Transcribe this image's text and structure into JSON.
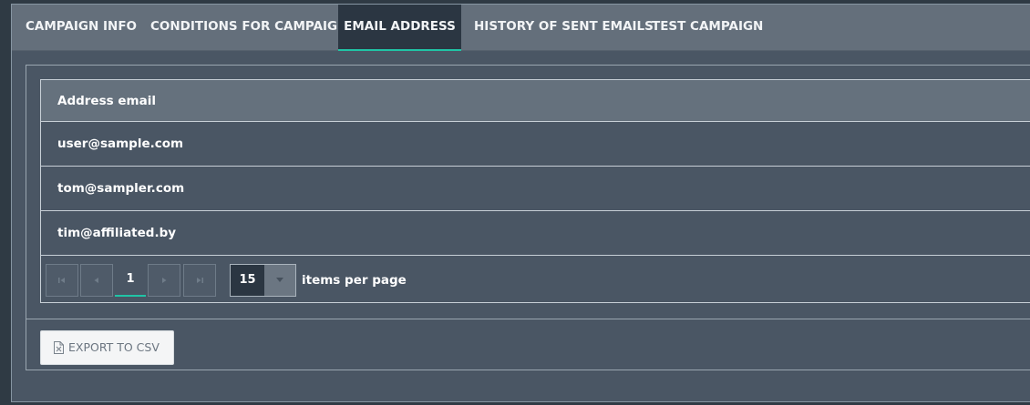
{
  "tabs": [
    {
      "label": "CAMPAIGN INFO",
      "active": false
    },
    {
      "label": "CONDITIONS FOR CAMPAIGN",
      "active": false
    },
    {
      "label": "EMAIL ADDRESS",
      "active": true
    },
    {
      "label": "HISTORY OF SENT EMAILS",
      "active": false
    },
    {
      "label": "TEST CAMPAIGN",
      "active": false
    }
  ],
  "grid": {
    "columns": [
      "Address email"
    ],
    "rows": [
      [
        "user@sample.com"
      ],
      [
        "tom@sampler.com"
      ],
      [
        "tim@affiliated.by"
      ]
    ]
  },
  "pager": {
    "first_icon": "first-page-icon",
    "prev_icon": "prev-page-icon",
    "current_page": "1",
    "next_icon": "next-page-icon",
    "last_icon": "last-page-icon",
    "page_size": "15",
    "page_size_label": "items per page"
  },
  "export": {
    "icon": "excel-file-icon",
    "label": "EXPORT TO CSV"
  },
  "colors": {
    "accent": "#20c4a6",
    "active_tab_bg": "#2b3642",
    "tabbar_bg": "#646f7b",
    "panel_bg": "#4a5664",
    "header_bg": "#65717d"
  }
}
